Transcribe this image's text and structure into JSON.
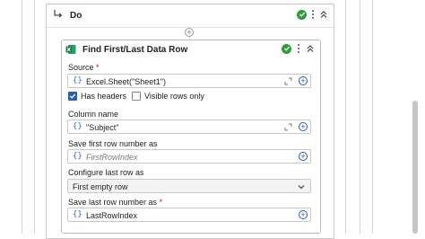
{
  "do_block": {
    "title": "Do",
    "status_icon": "check-circle-icon",
    "more_icon": "more-vertical-icon",
    "collapse_icon": "double-chevron-up-icon"
  },
  "card": {
    "title": "Find First/Last Data Row",
    "app_icon": "excel-icon",
    "fields": {
      "source": {
        "label": "Source",
        "required": "*",
        "value": "Excel.Sheet(\"Sheet1\")"
      },
      "has_headers": {
        "label": "Has headers",
        "checked": true
      },
      "visible_rows_only": {
        "label": "Visible rows only",
        "checked": false
      },
      "column_name": {
        "label": "Column name",
        "value": "\"Subject\""
      },
      "save_first_row": {
        "label": "Save first row number as",
        "placeholder": "FirstRowIndex"
      },
      "configure_last_row": {
        "label": "Configure last row as",
        "value": "First empty row"
      },
      "save_last_row": {
        "label": "Save last row number as",
        "required": "*",
        "value": "LastRowIndex"
      }
    }
  },
  "glyphs": {
    "brace": "{}",
    "plus": "+"
  },
  "colors": {
    "accent": "#2b5fa8",
    "success": "#2e9d3a",
    "required": "#c50f1f",
    "excel": "#1d6f42"
  }
}
